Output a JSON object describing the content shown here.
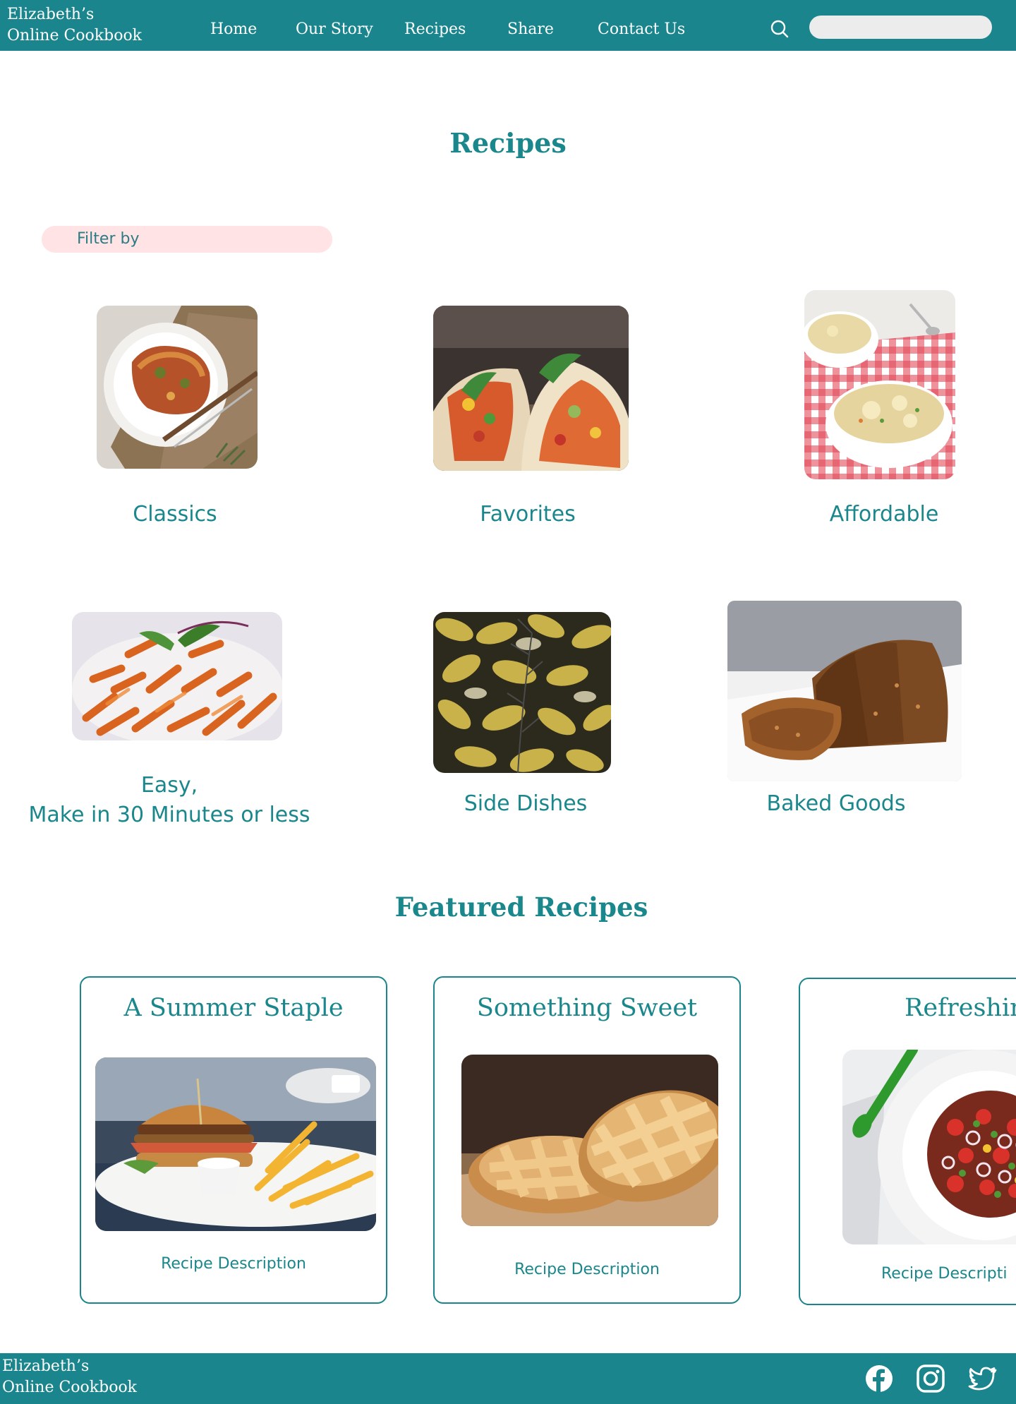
{
  "header": {
    "brand_line1": "Elizabeth’s",
    "brand_line2": "Online Cookbook",
    "nav": [
      "Home",
      "Our Story",
      "Recipes",
      "Share",
      "Contact Us"
    ],
    "search_placeholder": ""
  },
  "main": {
    "title": "Recipes",
    "filter_label": "Filter by",
    "categories": [
      {
        "label": "Classics",
        "image": "lasagna-photo"
      },
      {
        "label": "Favorites",
        "image": "tacos-photo"
      },
      {
        "label": "Affordable",
        "image": "soup-photo"
      },
      {
        "label_line1": "Easy,",
        "label_line2": "Make in 30 Minutes or less",
        "image": "pasta-photo"
      },
      {
        "label": "Side Dishes",
        "image": "roasted-potatoes-photo"
      },
      {
        "label": "Baked Goods",
        "image": "bread-loaf-photo"
      }
    ]
  },
  "featured": {
    "title": "Featured Recipes",
    "cards": [
      {
        "title": "A Summer Staple",
        "description": "Recipe Description",
        "image": "burger-fries-photo"
      },
      {
        "title": "Something Sweet",
        "description": "Recipe Description",
        "image": "lattice-pie-photo"
      },
      {
        "title": "Refreshin",
        "description": "Recipe Descripti",
        "image": "salad-photo"
      }
    ]
  },
  "footer": {
    "brand_line1": "Elizabeth’s",
    "brand_line2": "Online Cookbook",
    "social_icons": [
      "facebook-icon",
      "instagram-icon",
      "twitter-icon"
    ]
  },
  "colors": {
    "brand": "#1a858c",
    "text_accent": "#1a878c",
    "filter_bg": "#ffe3e5",
    "search_bg": "#ececec"
  }
}
